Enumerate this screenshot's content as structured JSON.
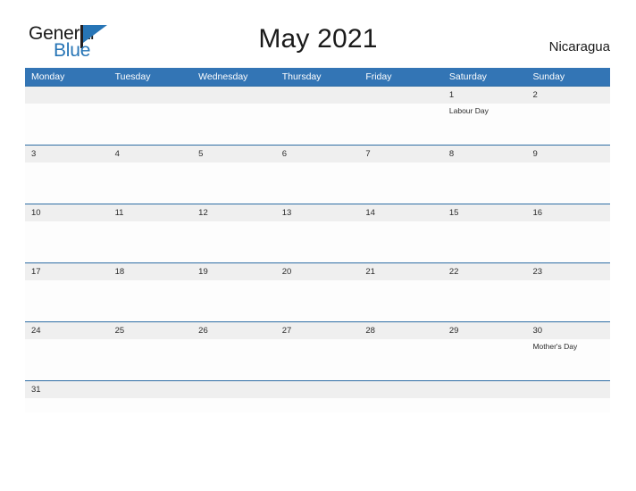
{
  "logo": {
    "word_one": "General",
    "word_two": "Blue",
    "flag_icon": "triangle-flag-icon",
    "brand_color": "#2775b6"
  },
  "header": {
    "title": "May 2021",
    "country": "Nicaragua"
  },
  "calendar": {
    "header_color": "#3375b5",
    "row_border_color": "#2e6da4",
    "date_strip_color": "#efefef",
    "weekdays": [
      "Monday",
      "Tuesday",
      "Wednesday",
      "Thursday",
      "Friday",
      "Saturday",
      "Sunday"
    ],
    "weeks": [
      {
        "days": [
          {
            "date": "",
            "event": ""
          },
          {
            "date": "",
            "event": ""
          },
          {
            "date": "",
            "event": ""
          },
          {
            "date": "",
            "event": ""
          },
          {
            "date": "",
            "event": ""
          },
          {
            "date": "1",
            "event": "Labour Day"
          },
          {
            "date": "2",
            "event": ""
          }
        ]
      },
      {
        "days": [
          {
            "date": "3",
            "event": ""
          },
          {
            "date": "4",
            "event": ""
          },
          {
            "date": "5",
            "event": ""
          },
          {
            "date": "6",
            "event": ""
          },
          {
            "date": "7",
            "event": ""
          },
          {
            "date": "8",
            "event": ""
          },
          {
            "date": "9",
            "event": ""
          }
        ]
      },
      {
        "days": [
          {
            "date": "10",
            "event": ""
          },
          {
            "date": "11",
            "event": ""
          },
          {
            "date": "12",
            "event": ""
          },
          {
            "date": "13",
            "event": ""
          },
          {
            "date": "14",
            "event": ""
          },
          {
            "date": "15",
            "event": ""
          },
          {
            "date": "16",
            "event": ""
          }
        ]
      },
      {
        "days": [
          {
            "date": "17",
            "event": ""
          },
          {
            "date": "18",
            "event": ""
          },
          {
            "date": "19",
            "event": ""
          },
          {
            "date": "20",
            "event": ""
          },
          {
            "date": "21",
            "event": ""
          },
          {
            "date": "22",
            "event": ""
          },
          {
            "date": "23",
            "event": ""
          }
        ]
      },
      {
        "days": [
          {
            "date": "24",
            "event": ""
          },
          {
            "date": "25",
            "event": ""
          },
          {
            "date": "26",
            "event": ""
          },
          {
            "date": "27",
            "event": ""
          },
          {
            "date": "28",
            "event": ""
          },
          {
            "date": "29",
            "event": ""
          },
          {
            "date": "30",
            "event": "Mother's Day"
          }
        ]
      },
      {
        "days": [
          {
            "date": "31",
            "event": ""
          },
          {
            "date": "",
            "event": ""
          },
          {
            "date": "",
            "event": ""
          },
          {
            "date": "",
            "event": ""
          },
          {
            "date": "",
            "event": ""
          },
          {
            "date": "",
            "event": ""
          },
          {
            "date": "",
            "event": ""
          }
        ]
      }
    ]
  }
}
